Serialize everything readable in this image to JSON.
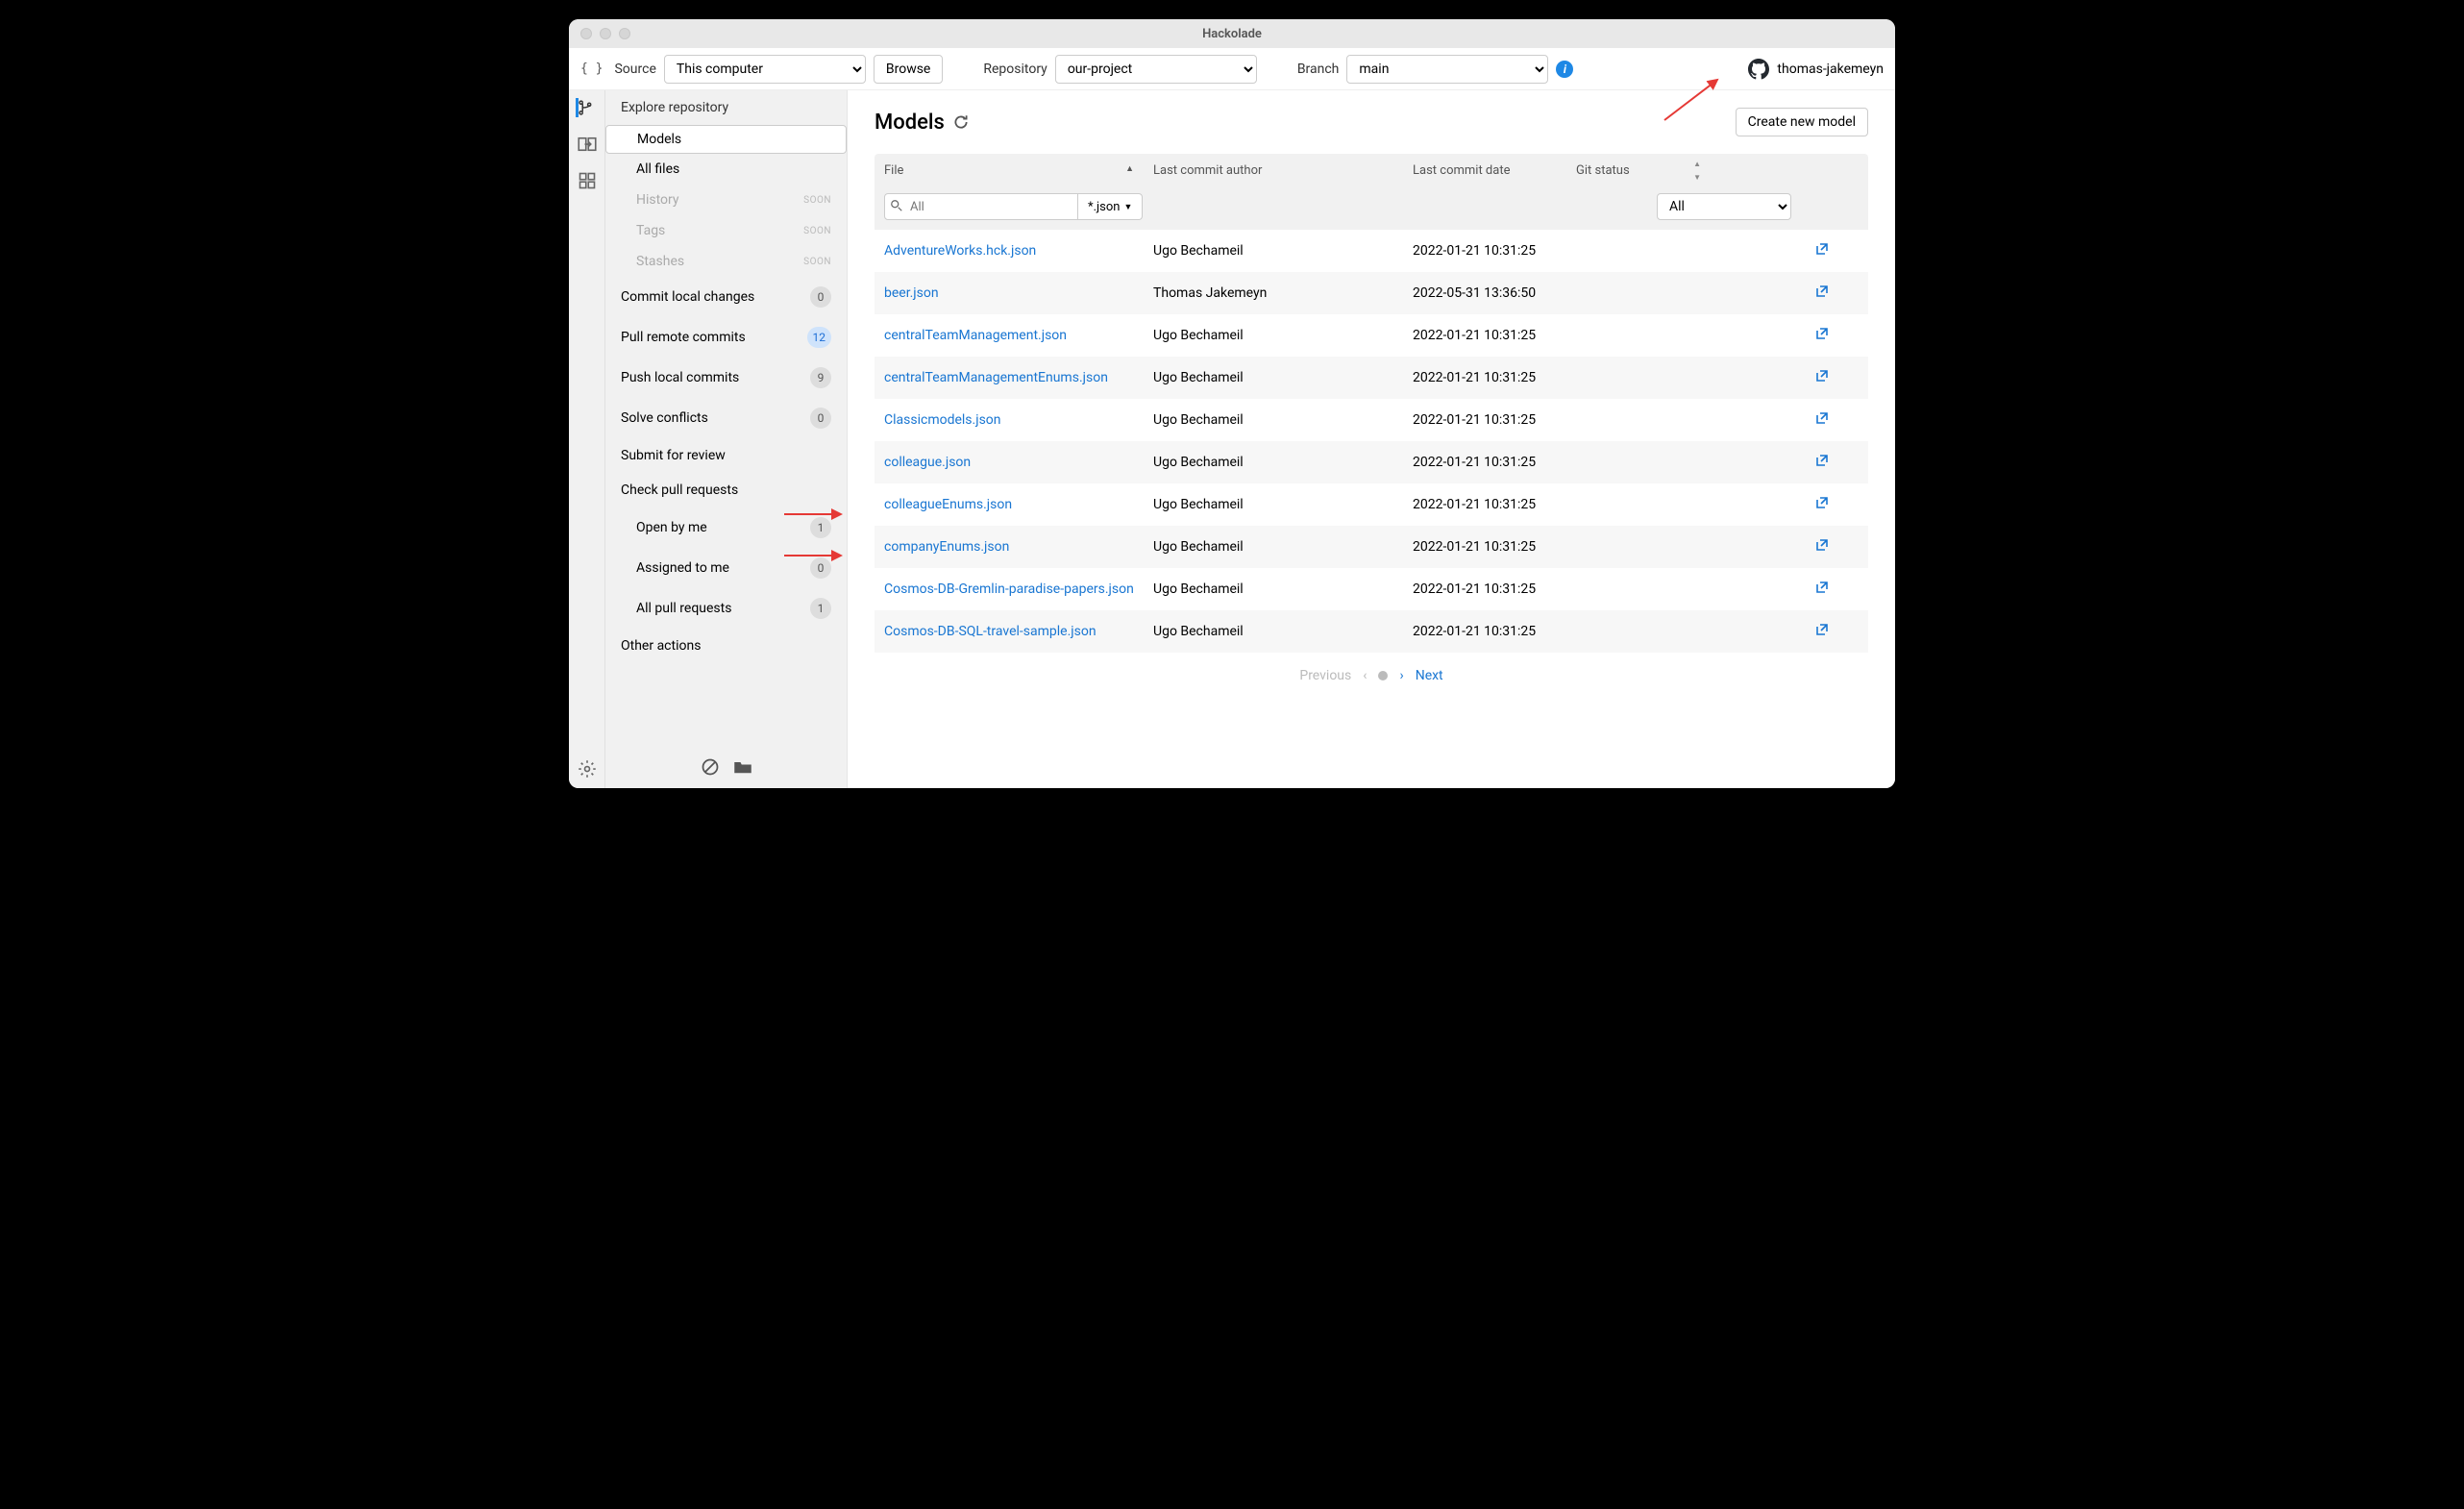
{
  "window": {
    "title": "Hackolade"
  },
  "topbar": {
    "source_label": "Source",
    "source_value": "This computer",
    "browse_label": "Browse",
    "repo_label": "Repository",
    "repo_value": "our-project",
    "branch_label": "Branch",
    "branch_value": "main"
  },
  "user": {
    "name": "thomas-jakemeyn"
  },
  "sidebar": {
    "explore": "Explore repository",
    "items": [
      {
        "label": "Models",
        "selected": true
      },
      {
        "label": "All files"
      },
      {
        "label": "History",
        "soon": true
      },
      {
        "label": "Tags",
        "soon": true
      },
      {
        "label": "Stashes",
        "soon": true
      }
    ],
    "rows": [
      {
        "label": "Commit local changes",
        "badge": "0"
      },
      {
        "label": "Pull remote commits",
        "badge": "12",
        "blue": true
      },
      {
        "label": "Push local commits",
        "badge": "9"
      },
      {
        "label": "Solve conflicts",
        "badge": "0"
      },
      {
        "label": "Submit for review"
      },
      {
        "label": "Check pull requests"
      }
    ],
    "pr_subs": [
      {
        "label": "Open by me",
        "badge": "1"
      },
      {
        "label": "Assigned to me",
        "badge": "0"
      },
      {
        "label": "All pull requests",
        "badge": "1"
      }
    ],
    "other": "Other actions",
    "soon_label": "SOON"
  },
  "main": {
    "title": "Models",
    "create_btn": "Create new model"
  },
  "table": {
    "headers": {
      "file": "File",
      "author": "Last commit author",
      "date": "Last commit date",
      "status": "Git status"
    },
    "filter_placeholder": "All",
    "ext_filter": "*.json",
    "status_filter": "All",
    "rows": [
      {
        "file": "AdventureWorks.hck.json",
        "author": "Ugo Bechameil",
        "date": "2022-01-21 10:31:25"
      },
      {
        "file": "beer.json",
        "author": "Thomas Jakemeyn",
        "date": "2022-05-31 13:36:50"
      },
      {
        "file": "centralTeamManagement.json",
        "author": "Ugo Bechameil",
        "date": "2022-01-21 10:31:25"
      },
      {
        "file": "centralTeamManagementEnums.json",
        "author": "Ugo Bechameil",
        "date": "2022-01-21 10:31:25"
      },
      {
        "file": "Classicmodels.json",
        "author": "Ugo Bechameil",
        "date": "2022-01-21 10:31:25"
      },
      {
        "file": "colleague.json",
        "author": "Ugo Bechameil",
        "date": "2022-01-21 10:31:25"
      },
      {
        "file": "colleagueEnums.json",
        "author": "Ugo Bechameil",
        "date": "2022-01-21 10:31:25"
      },
      {
        "file": "companyEnums.json",
        "author": "Ugo Bechameil",
        "date": "2022-01-21 10:31:25"
      },
      {
        "file": "Cosmos-DB-Gremlin-paradise-papers.json",
        "author": "Ugo Bechameil",
        "date": "2022-01-21 10:31:25"
      },
      {
        "file": "Cosmos-DB-SQL-travel-sample.json",
        "author": "Ugo Bechameil",
        "date": "2022-01-21 10:31:25"
      }
    ]
  },
  "pager": {
    "prev": "Previous",
    "next": "Next"
  }
}
